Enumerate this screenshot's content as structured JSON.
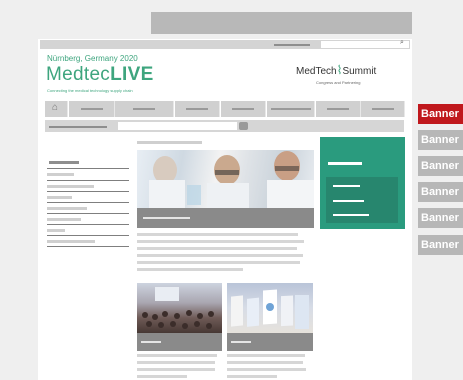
{
  "header": {
    "location": "Nürnberg, Germany 2020",
    "brand_left": "Medtec",
    "brand_right": "LIVE",
    "tagline": "Connecting the medical technology supply chain",
    "summit_left": "MedTech",
    "summit_right": "Summit",
    "summit_sub": "Congress and Partnering"
  },
  "colors": {
    "brand_green": "#3ea57e",
    "teal_panel": "#2a9b7e",
    "banner_red": "#c0181d",
    "banner_gray": "#b7b7b7"
  },
  "banners": [
    {
      "label": "Banner",
      "highlighted": true
    },
    {
      "label": "Banner",
      "highlighted": false
    },
    {
      "label": "Banner",
      "highlighted": false
    },
    {
      "label": "Banner",
      "highlighted": false
    },
    {
      "label": "Banner",
      "highlighted": false
    },
    {
      "label": "Banner",
      "highlighted": false
    }
  ],
  "icons": {
    "search": "🔍",
    "home": "⌂"
  }
}
